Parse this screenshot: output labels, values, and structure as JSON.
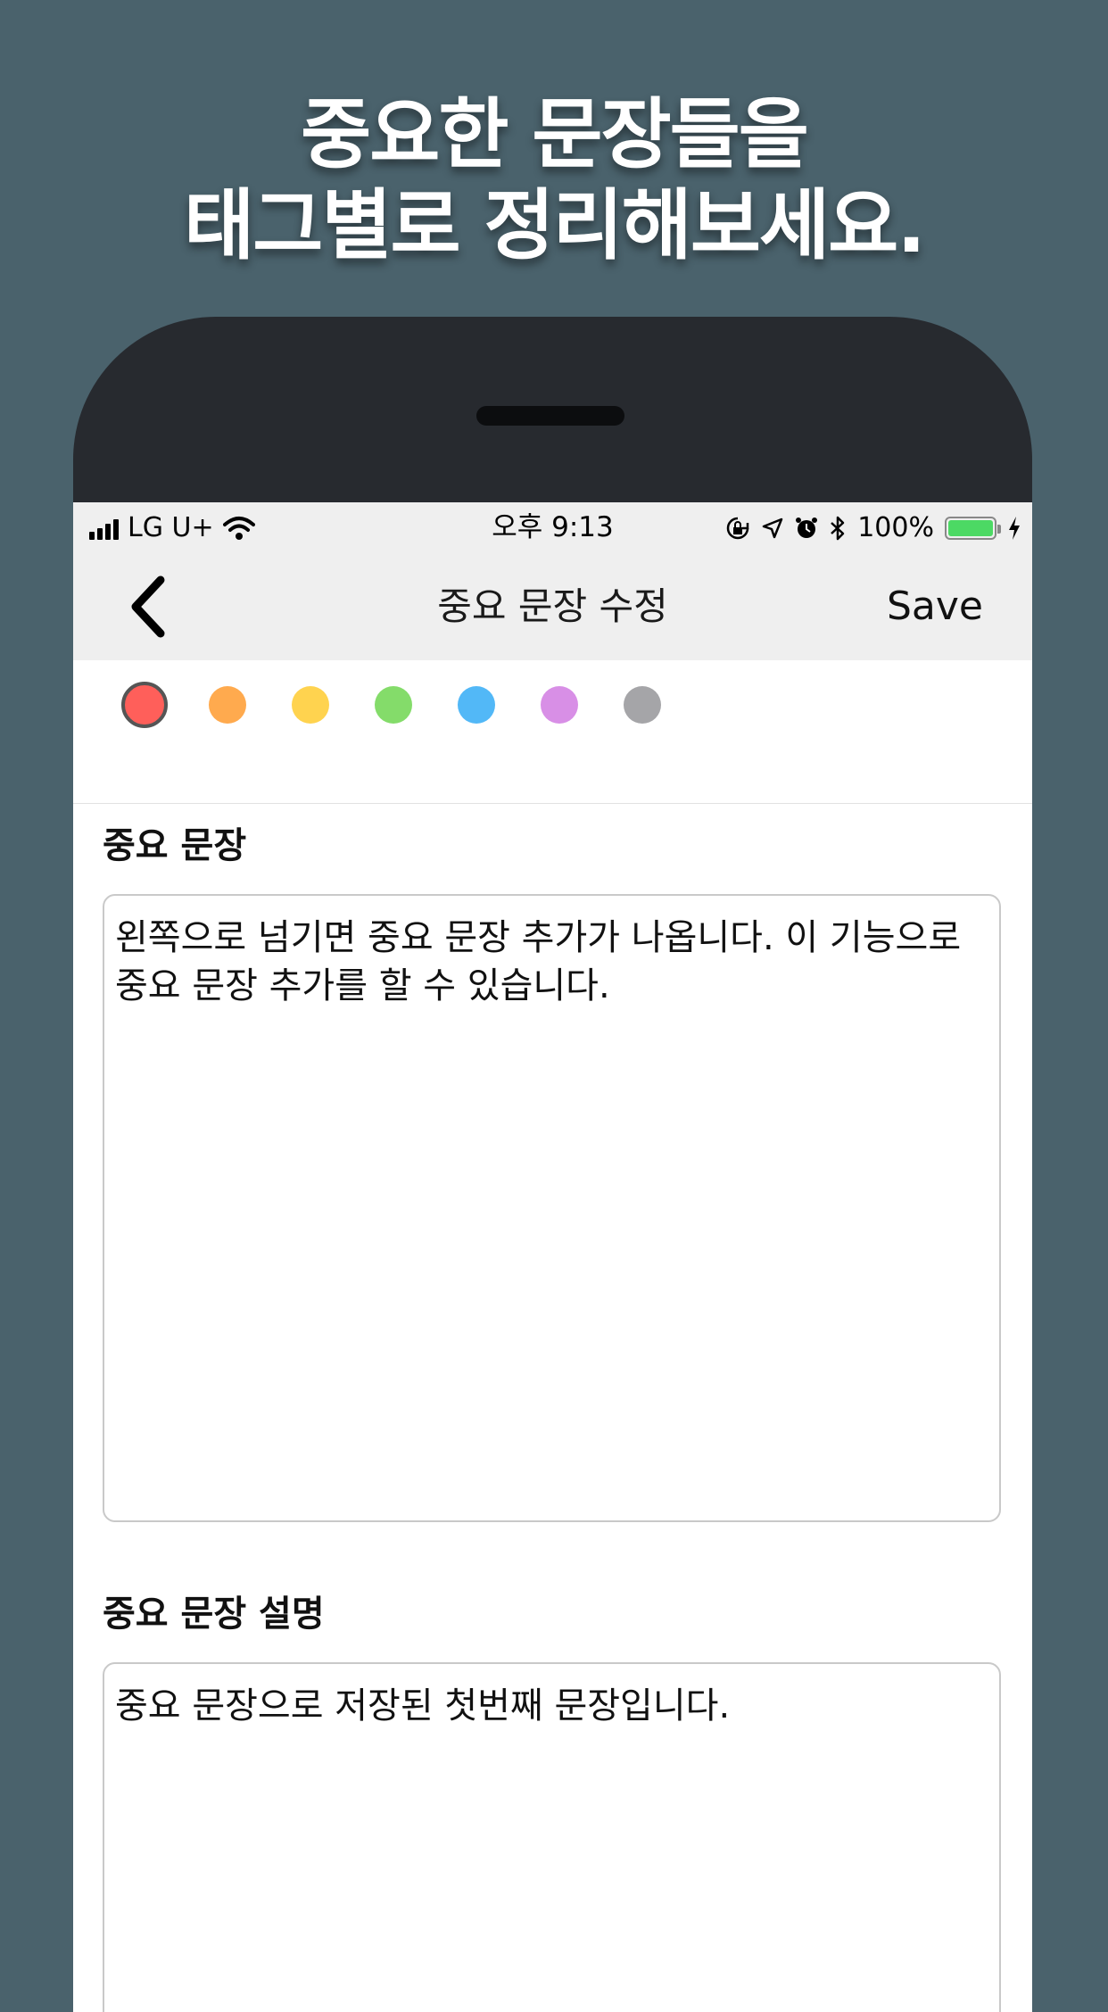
{
  "headline": {
    "line1": "중요한 문장들을",
    "line2": "태그별로 정리해보세요."
  },
  "status_bar": {
    "carrier": "LG U+",
    "time": "오후 9:13",
    "battery": "100%",
    "icons": [
      "signal-icon",
      "wifi-icon",
      "orientation-lock-icon",
      "location-icon",
      "alarm-icon",
      "bluetooth-icon",
      "battery-icon",
      "charging-icon"
    ]
  },
  "nav": {
    "title": "중요 문장 수정",
    "save_label": "Save",
    "back_icon": "chevron-left-icon"
  },
  "tag_colors": [
    {
      "name": "red",
      "hex": "#ff5f5a",
      "selected": true
    },
    {
      "name": "orange",
      "hex": "#ffaa4e"
    },
    {
      "name": "yellow",
      "hex": "#ffd34f"
    },
    {
      "name": "green",
      "hex": "#84dc6a"
    },
    {
      "name": "blue",
      "hex": "#52b8f7"
    },
    {
      "name": "purple",
      "hex": "#d88fe6"
    },
    {
      "name": "gray",
      "hex": "#a5a5a8"
    }
  ],
  "sentence": {
    "label": "중요 문장",
    "value": "왼쪽으로 넘기면 중요 문장 추가가 나옵니다. 이 기능으로 중요 문장 추가를 할 수 있습니다."
  },
  "description": {
    "label": "중요 문장 설명",
    "value": "중요 문장으로 저장된 첫번째 문장입니다."
  },
  "colors": {
    "background": "#4a626c",
    "phone_body": "#272a2f",
    "bar_gray": "#efefef",
    "battery_green": "#4cd964"
  }
}
